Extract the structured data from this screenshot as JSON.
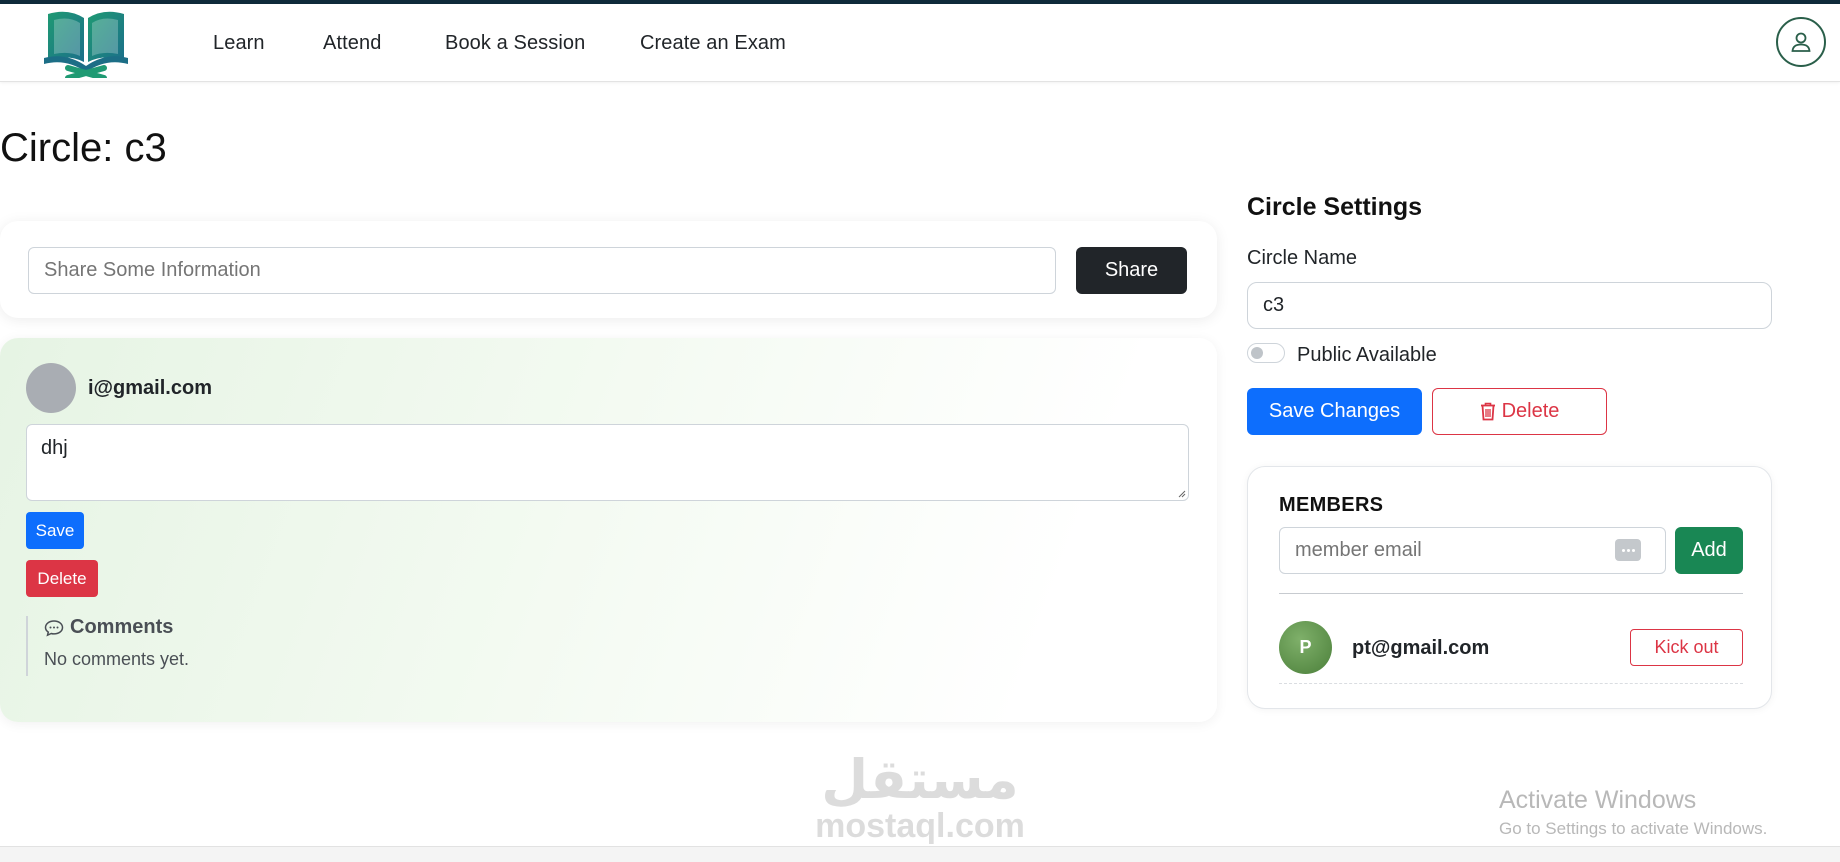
{
  "nav": {
    "links": [
      "Learn",
      "Attend",
      "Book a Session",
      "Create an Exam"
    ]
  },
  "page": {
    "title": "Circle: c3"
  },
  "share": {
    "placeholder": "Share Some Information",
    "button_label": "Share"
  },
  "post": {
    "author": "i@gmail.com",
    "text": "dhj",
    "save_label": "Save",
    "delete_label": "Delete",
    "comments_title": "Comments",
    "comments_empty": "No comments yet."
  },
  "settings": {
    "title": "Circle Settings",
    "name_label": "Circle Name",
    "name_value": "c3",
    "public_label": "Public Available",
    "public_enabled": false,
    "save_label": "Save Changes",
    "delete_label": "Delete"
  },
  "members": {
    "title": "MEMBERS",
    "email_placeholder": "member email",
    "add_label": "Add",
    "list": [
      {
        "initial": "P",
        "email": "pt@gmail.com",
        "kick_label": "Kick out"
      }
    ]
  },
  "watermark": {
    "arabic": "مستقل",
    "latin": "mostaql.com"
  },
  "os_notice": {
    "title": "Activate Windows",
    "subtitle": "Go to Settings to activate Windows."
  },
  "colors": {
    "primary": "#0d6efd",
    "danger": "#dc3545",
    "success": "#198754",
    "dark": "#212529",
    "logo_green": "#1a8a6e"
  }
}
